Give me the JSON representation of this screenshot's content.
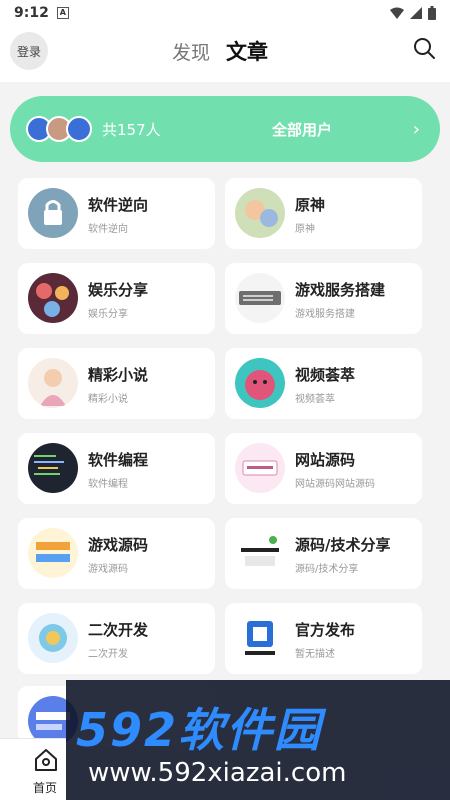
{
  "status_bar": {
    "time": "9:12",
    "notif_letter": "A"
  },
  "header": {
    "login_label": "登录",
    "tabs": [
      "发现",
      "文章"
    ]
  },
  "banner": {
    "count_text": "共157人",
    "all_users": "全部用户",
    "arrow": "›"
  },
  "categories": [
    {
      "title": "软件逆向",
      "desc": "软件逆向"
    },
    {
      "title": "原神",
      "desc": "原神"
    },
    {
      "title": "娱乐分享",
      "desc": "娱乐分享"
    },
    {
      "title": "游戏服务搭建",
      "desc": "游戏服务搭建"
    },
    {
      "title": "精彩小说",
      "desc": "精彩小说"
    },
    {
      "title": "视频荟萃",
      "desc": "视频荟萃"
    },
    {
      "title": "软件编程",
      "desc": "软件编程"
    },
    {
      "title": "网站源码",
      "desc": "网站源码网站源码"
    },
    {
      "title": "游戏源码",
      "desc": "游戏源码"
    },
    {
      "title": "源码/技术分享",
      "desc": "源码/技术分享"
    },
    {
      "title": "二次开发",
      "desc": "二次开发"
    },
    {
      "title": "官方发布",
      "desc": "暂无描述"
    }
  ],
  "bottom_nav": {
    "home_label": "首页"
  },
  "watermark": {
    "brand": "592软件园",
    "url": "www.592xiazai.com"
  }
}
